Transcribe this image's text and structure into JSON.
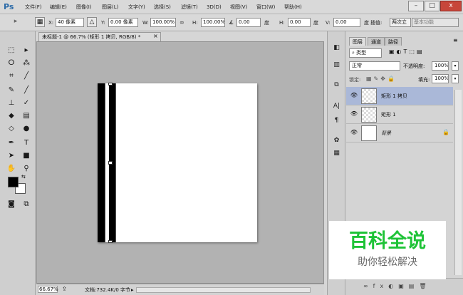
{
  "app": {
    "logo": "Ps"
  },
  "menu": [
    "文件(F)",
    "编辑(E)",
    "图像(I)",
    "图层(L)",
    "文字(Y)",
    "选择(S)",
    "滤镜(T)",
    "3D(D)",
    "视图(V)",
    "窗口(W)",
    "帮助(H)"
  ],
  "window_controls": {
    "minimize": "–",
    "restore": "□",
    "close": "x"
  },
  "options": {
    "x_label": "X:",
    "x_value": "40 像素",
    "y_label": "Y:",
    "y_value": "0.00 像素",
    "w_label": "W:",
    "w_value": "100.00%",
    "h_label": "H:",
    "h_value": "100.00%",
    "angle_value": "0.00",
    "angle_unit": "度",
    "hskew_label": "H:",
    "hskew_value": "0.00",
    "hskew_unit": "度",
    "vskew_label": "V:",
    "vskew_value": "0.00",
    "vskew_unit": "度",
    "interp_label": "插值:",
    "interp_value": "两次立",
    "workspace": "基本功能"
  },
  "document": {
    "tab_title": "未标题-1 @ 66.7% (矩形 1 拷贝, RGB/8) *",
    "tab_close": "×",
    "zoom": "66.67%",
    "doc_info": "文档:732.4K/0 字节"
  },
  "layers_panel": {
    "tabs": [
      "图层",
      "通道",
      "路径"
    ],
    "filter": "类型",
    "blend_mode": "正常",
    "opacity_label": "不透明度:",
    "opacity_value": "100%",
    "lock_label": "锁定:",
    "fill_label": "填充:",
    "fill_value": "100%",
    "layers": [
      {
        "name": "矩形 1 拷贝",
        "selected": true
      },
      {
        "name": "矩形 1",
        "selected": false
      },
      {
        "name": "背景",
        "selected": false
      }
    ]
  },
  "watermark": {
    "title": "百科全说",
    "subtitle": "助你轻松解决"
  },
  "colors": {
    "selected_layer": "#aab8d8",
    "watermark_green": "#1ec337",
    "ps_blue": "#2d6ba8"
  }
}
